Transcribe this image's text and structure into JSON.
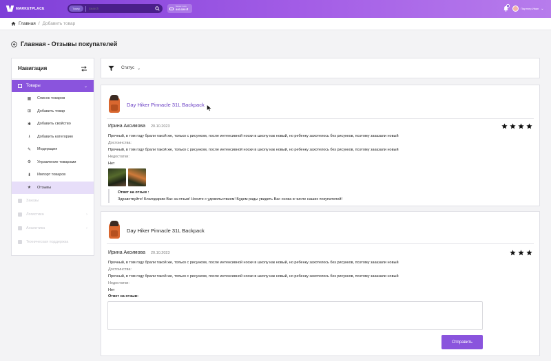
{
  "header": {
    "logo_text": "MARKETPLACE",
    "search_scope": "Товар",
    "search_placeholder": "Search",
    "balance_label": "Баланс счета",
    "balance_value": "440.320 ₽",
    "notification_count": "1",
    "user_name": "Партнер Иван"
  },
  "breadcrumb": {
    "home": "Главная",
    "separator": "/",
    "current": "Добавить товар"
  },
  "page": {
    "title": "Главная - Отзывы покупателей"
  },
  "sidebar": {
    "title": "Навигация",
    "group": "Товары",
    "items": [
      {
        "label": "Список товаров",
        "icon": "boxes-icon"
      },
      {
        "label": "Добавить товар",
        "icon": "plus-square-icon"
      },
      {
        "label": "Добавить свойство",
        "icon": "add-property-icon"
      },
      {
        "label": "Добавить категорию",
        "icon": "tray-icon"
      },
      {
        "label": "Модерация",
        "icon": "edit-icon"
      },
      {
        "label": "Управление товарами",
        "icon": "manage-icon"
      },
      {
        "label": "Импорт товаров",
        "icon": "import-icon"
      },
      {
        "label": "Отзывы",
        "icon": "reviews-icon"
      }
    ],
    "muted": [
      {
        "label": "Заказы"
      },
      {
        "label": "Логистика"
      },
      {
        "label": "Аналитика"
      },
      {
        "label": "Техническая поддержка"
      }
    ]
  },
  "filters": {
    "status_label": "Статус"
  },
  "reviews": [
    {
      "product": "Day Hiker Pinnacle 31L Backpack",
      "author": "Ирина Аксимова",
      "date": "20.10.2023",
      "rating": 4,
      "text": "Прочный, в том году брали такой же, только с рисунком, после интенсивной носки в школу как новый, но ребенку захотелось без рисунков, поэтому заказали новый",
      "pros_label": "Достоинства:",
      "pros": "Прочный, в том году брали такой же, только с рисунком, после интенсивной носки в школу как новый, но ребенку захотелось без рисунков, поэтому заказали новый",
      "cons_label": "Недостатки:",
      "cons": "Нет",
      "answer_label": "Ответ на отзыв :",
      "answer": "Здравствуйте! Благодарим Вас за отзыв! Носите с удовольствием! Будем рады увидеть Вас снова в числе наших покупателей!"
    },
    {
      "product": "Day Hiker Pinnacle 31L Backpack",
      "author": "Ирина Аксимова",
      "date": "20.10.2023",
      "rating": 3,
      "text": "Прочный, в том году брали такой же, только с рисунком, после интенсивной носки в школу как новый, но ребенку захотелось без рисунков, поэтому заказали новый",
      "pros_label": "Достоинства:",
      "pros": "Прочный, в том году брали такой же, только с рисунком, после интенсивной носки в школу как новый, но ребенку захотелось без рисунков, поэтому заказали новый",
      "cons_label": "Недостатки:",
      "cons": "Нет",
      "reply_label": "Ответ на отзыв:",
      "reply_value": "",
      "send_label": "Отправить"
    }
  ],
  "colors": {
    "accent": "#8a54dd",
    "active_bg": "#e7def9",
    "link": "#6a3fc4"
  }
}
